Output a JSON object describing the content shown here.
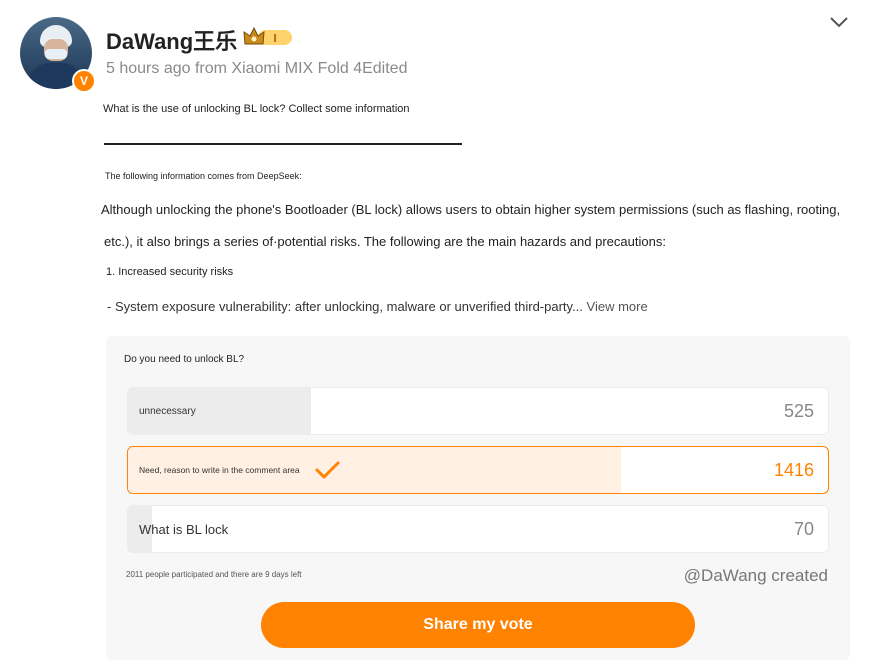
{
  "post": {
    "author": "DaWang王乐",
    "verified_mark": "V",
    "level_badge": "crown I",
    "meta": "5 hours ago from Xiaomi MIX Fold 4Edited",
    "title": "What is the use of unlocking BL lock? Collect some information",
    "source_note": "The following information comes from DeepSeek:",
    "paragraph_1": "Although unlocking the phone's Bootloader (BL lock) allows users to obtain higher system permissions (such as flashing, rooting,",
    "paragraph_2": "etc.), it also brings a series of·potential risks. The following are the main hazards and precautions:",
    "list_item_1": "1. Increased security risks",
    "list_item_2": " - System exposure vulnerability: after unlocking, malware or unverified third-party...",
    "view_more": " View more"
  },
  "poll": {
    "question": "Do you need to unlock BL?",
    "options": [
      {
        "label": "unnecessary",
        "count": "525",
        "share": 0.262,
        "selected": false
      },
      {
        "label": "Need, reason to write in the comment area",
        "count": "1416",
        "share": 0.704,
        "selected": true
      },
      {
        "label": "What is BL lock",
        "count": "70",
        "share": 0.034,
        "selected": false
      }
    ],
    "participants": "2011 people participated and there are 9 days left",
    "creator": "@DaWang created",
    "share_button": "Share my vote"
  },
  "colors": {
    "accent": "#ff8200",
    "selected_fill": "#fff0e3",
    "bar_fill": "#ececec"
  },
  "icons": {
    "expand": "chevron-down-icon",
    "selected_check": "checkmark-icon",
    "verified": "verified-v-icon",
    "crown": "crown-icon"
  }
}
